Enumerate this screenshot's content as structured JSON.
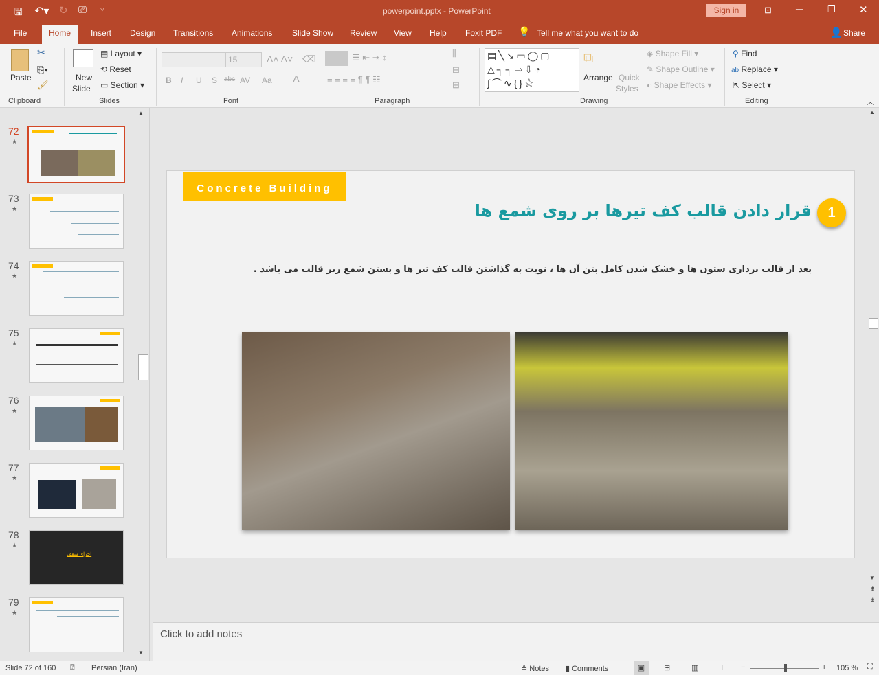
{
  "titlebar": {
    "title": "powerpoint.pptx  -  PowerPoint",
    "sign_in": "Sign in"
  },
  "tabs": [
    "File",
    "Home",
    "Insert",
    "Design",
    "Transitions",
    "Animations",
    "Slide Show",
    "Review",
    "View",
    "Help",
    "Foxit PDF"
  ],
  "tell_me": "Tell me what you want to do",
  "share": "Share",
  "ribbon": {
    "clipboard": {
      "paste": "Paste",
      "label": "Clipboard"
    },
    "slides": {
      "new_slide": "New",
      "new_slide2": "Slide",
      "layout": "Layout",
      "reset": "Reset",
      "section": "Section",
      "label": "Slides"
    },
    "font": {
      "size": "15",
      "label": "Font",
      "bold": "B",
      "italic": "I",
      "underline": "U",
      "shadow": "S",
      "strike": "abc",
      "spacing": "AV",
      "case": "Aa"
    },
    "paragraph": {
      "label": "Paragraph"
    },
    "drawing": {
      "arrange": "Arrange",
      "quick": "Quick",
      "styles": "Styles",
      "shape_fill": "Shape Fill",
      "shape_outline": "Shape Outline",
      "shape_effects": "Shape Effects",
      "label": "Drawing"
    },
    "editing": {
      "find": "Find",
      "replace": "Replace",
      "select": "Select",
      "label": "Editing"
    }
  },
  "thumbnails": [
    {
      "num": "72",
      "selected": true
    },
    {
      "num": "73"
    },
    {
      "num": "74"
    },
    {
      "num": "75"
    },
    {
      "num": "76"
    },
    {
      "num": "77"
    },
    {
      "num": "78",
      "dark": true,
      "text": "اجرای سقف"
    },
    {
      "num": "79"
    }
  ],
  "slide": {
    "banner": "Concrete Building",
    "badge": "1",
    "title": "قرار دادن قالب کف تیرها بر روی شمع ها",
    "body": "بعد از قالب برداری ستون ها و خشک شدن کامل بتن آن ها ، نوبت به گذاشتن قالب کف تیر ها و بستن شمع زیر قالب می باشد ."
  },
  "colors": {
    "accent": "#b7472a",
    "banner": "#ffc000",
    "title": "#1a9aa0"
  },
  "notes_placeholder": "Click to add notes",
  "status": {
    "slide": "Slide 72 of 160",
    "language": "Persian (Iran)",
    "notes": "Notes",
    "comments": "Comments",
    "zoom": "105 %"
  }
}
